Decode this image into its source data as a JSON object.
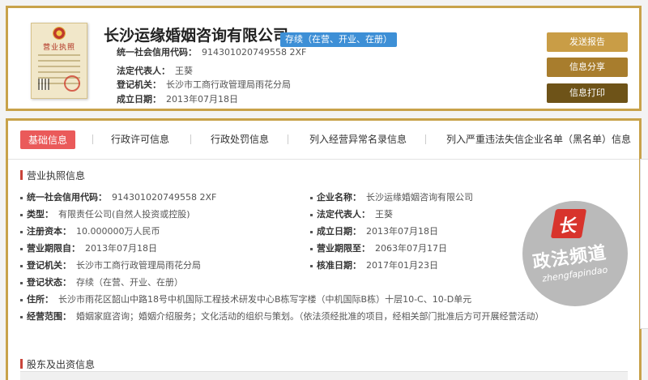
{
  "header": {
    "company_name": "长沙运缘婚姻咨询有限公司",
    "status_tag": "存续（在营、开业、在册）",
    "license_image_title": "营业执照",
    "rows": [
      {
        "label": "统一社会信用代码：",
        "value": "914301020749558 2XF"
      },
      {
        "label": "法定代表人：",
        "value": "王葵"
      },
      {
        "label": "登记机关：",
        "value": "长沙市工商行政管理局雨花分局"
      },
      {
        "label": "成立日期：",
        "value": "2013年07月18日"
      }
    ],
    "buttons": {
      "send_report": "发送报告",
      "share": "信息分享",
      "print": "信息打印"
    }
  },
  "tabs": [
    {
      "label": "基础信息",
      "active": true
    },
    {
      "label": "行政许可信息"
    },
    {
      "label": "行政处罚信息"
    },
    {
      "label": "列入经营异常名录信息"
    },
    {
      "label": "列入严重违法失信企业名单（黑名单）信息"
    }
  ],
  "license_section": {
    "title": "营业执照信息",
    "left": [
      {
        "label": "统一社会信用代码：",
        "value": "914301020749558 2XF"
      },
      {
        "label": "类型：",
        "value": "有限责任公司(自然人投资或控股)"
      },
      {
        "label": "注册资本：",
        "value": "10.000000万人民币"
      },
      {
        "label": "营业期限自：",
        "value": "2013年07月18日"
      },
      {
        "label": "登记机关：",
        "value": "长沙市工商行政管理局雨花分局"
      },
      {
        "label": "登记状态：",
        "value": "存续（在营、开业、在册）"
      }
    ],
    "right": [
      {
        "label": "企业名称：",
        "value": "长沙运缘婚姻咨询有限公司"
      },
      {
        "label": "法定代表人：",
        "value": "王葵"
      },
      {
        "label": "成立日期：",
        "value": "2013年07月18日"
      },
      {
        "label": "营业期限至：",
        "value": "2063年07月17日"
      },
      {
        "label": "核准日期：",
        "value": "2017年01月23日"
      }
    ],
    "address": {
      "label": "住所：",
      "value": "长沙市雨花区韶山中路18号中机国际工程技术研发中心B栋写字楼（中机国际B栋）十层10-C、10-D单元"
    },
    "scope": {
      "label": "经营范围：",
      "value": "婚姻家庭咨询；婚姻介绍服务；文化活动的组织与策划。（依法须经批准的项目，经相关部门批准后方可开展经营活动）"
    }
  },
  "shareholder_section": {
    "title": "股东及出资信息"
  },
  "watermark": {
    "cn": "政法频道",
    "en": "zhengfapindao"
  }
}
